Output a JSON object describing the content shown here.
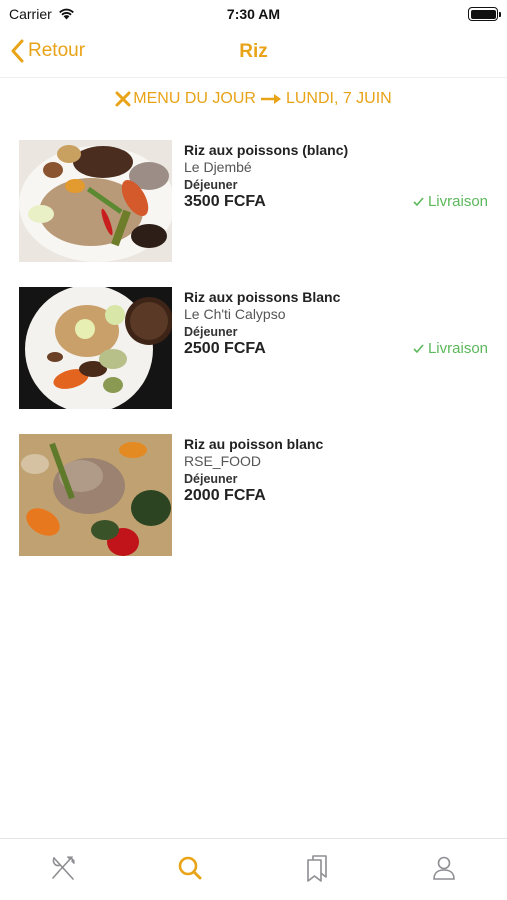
{
  "status_bar": {
    "carrier": "Carrier",
    "time": "7:30 AM"
  },
  "nav": {
    "back_label": "Retour",
    "title": "Riz"
  },
  "menu_header": {
    "prefix": "MENU DU JOUR",
    "date": "LUNDI, 7 JUIN"
  },
  "dishes": [
    {
      "name": "Riz aux poissons (blanc)",
      "restaurant": "Le Djembé",
      "meal": "Déjeuner",
      "price": "3500 FCFA",
      "delivery": "Livraison"
    },
    {
      "name": "Riz aux poissons Blanc",
      "restaurant": "Le Ch'ti Calypso",
      "meal": "Déjeuner",
      "price": "2500 FCFA",
      "delivery": "Livraison"
    },
    {
      "name": "Riz au poisson blanc",
      "restaurant": "RSE_FOOD",
      "meal": "Déjeuner",
      "price": "2000 FCFA",
      "delivery": null
    }
  ],
  "tabs": [
    {
      "icon": "cutlery-icon",
      "active": false
    },
    {
      "icon": "search-icon",
      "active": true
    },
    {
      "icon": "bookmarks-icon",
      "active": false
    },
    {
      "icon": "profile-icon",
      "active": false
    }
  ],
  "colors": {
    "accent": "#E8A317",
    "delivery": "#5CB85C",
    "inactive_icon": "#8e8e93"
  }
}
